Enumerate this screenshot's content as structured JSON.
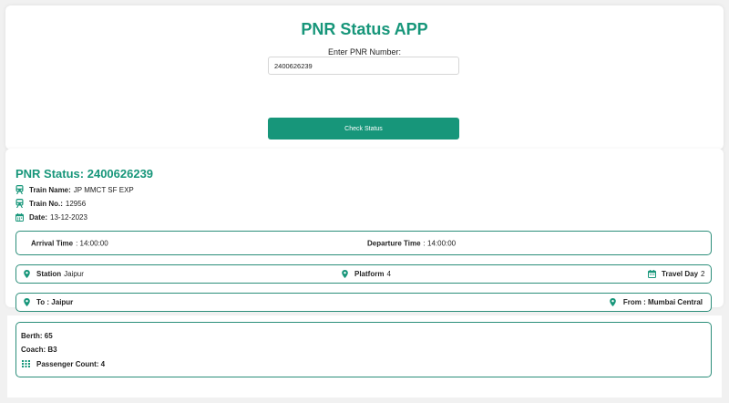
{
  "app": {
    "title": "PNR Status APP",
    "input_label": "Enter PNR Number:",
    "pnr_value": "2400626239",
    "check_button": "Check Status",
    "accent_color": "#17967a"
  },
  "status": {
    "heading": "PNR Status: 2400626239",
    "train_name_label": "Train Name:",
    "train_name": "JP MMCT SF EXP",
    "train_no_label": "Train No.:",
    "train_no": "12956",
    "date_label": "Date:",
    "date": "13-12-2023"
  },
  "timing": {
    "arrival_label": "Arrival Time",
    "arrival_value": ": 14:00:00",
    "departure_label": "Departure Time",
    "departure_value": ": 14:00:00"
  },
  "station_row": {
    "station_label": "Station",
    "station_value": "Jaipur",
    "platform_label": "Platform",
    "platform_value": "4",
    "travel_day_label": "Travel Day",
    "travel_day_value": "2"
  },
  "route": {
    "to_text": "To : Jaipur",
    "from_text": "From : Mumbai Central"
  },
  "passenger": {
    "berth_text": "Berth: 65",
    "coach_text": "Coach: B3",
    "count_text": "Passenger Count: 4"
  },
  "icons": {
    "train": "train-icon",
    "calendar": "calendar-icon",
    "location": "map-pin-icon",
    "grid": "grid-icon"
  }
}
